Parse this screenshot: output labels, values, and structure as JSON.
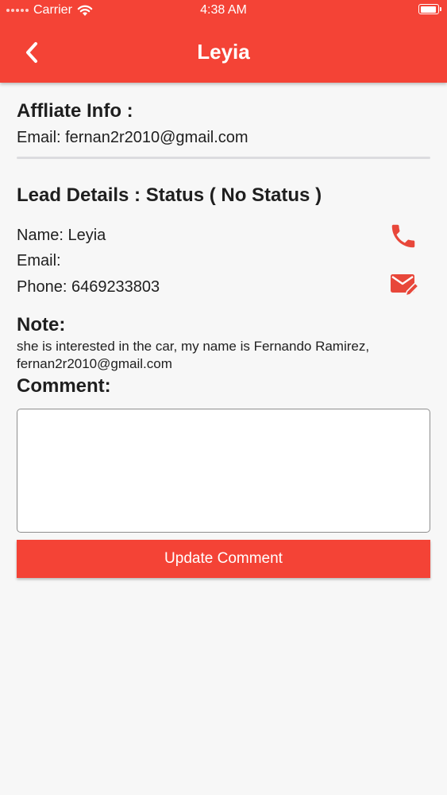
{
  "status_bar": {
    "carrier": "Carrier",
    "time": "4:38 AM"
  },
  "nav": {
    "title": "Leyia"
  },
  "affiliate": {
    "heading": "Affliate Info :",
    "email_line": "Email: fernan2r2010@gmail.com"
  },
  "lead": {
    "heading": "Lead Details : Status ( No Status )",
    "name_line": "Name: Leyia",
    "email_line": "Email:",
    "phone_line": "Phone: 6469233803"
  },
  "note": {
    "heading": "Note:",
    "text": "she is interested in the car, my name is Fernando Ramirez, fernan2r2010@gmail.com"
  },
  "comment": {
    "heading": "Comment:",
    "value": "",
    "button_label": "Update Comment"
  },
  "colors": {
    "accent": "#f44336",
    "background": "#f7f7f7",
    "text": "#1f1f1f"
  },
  "icons": {
    "back": "chevron-left-icon",
    "phone": "phone-icon",
    "email": "email-edit-icon",
    "wifi": "wifi-icon",
    "battery": "battery-icon"
  }
}
